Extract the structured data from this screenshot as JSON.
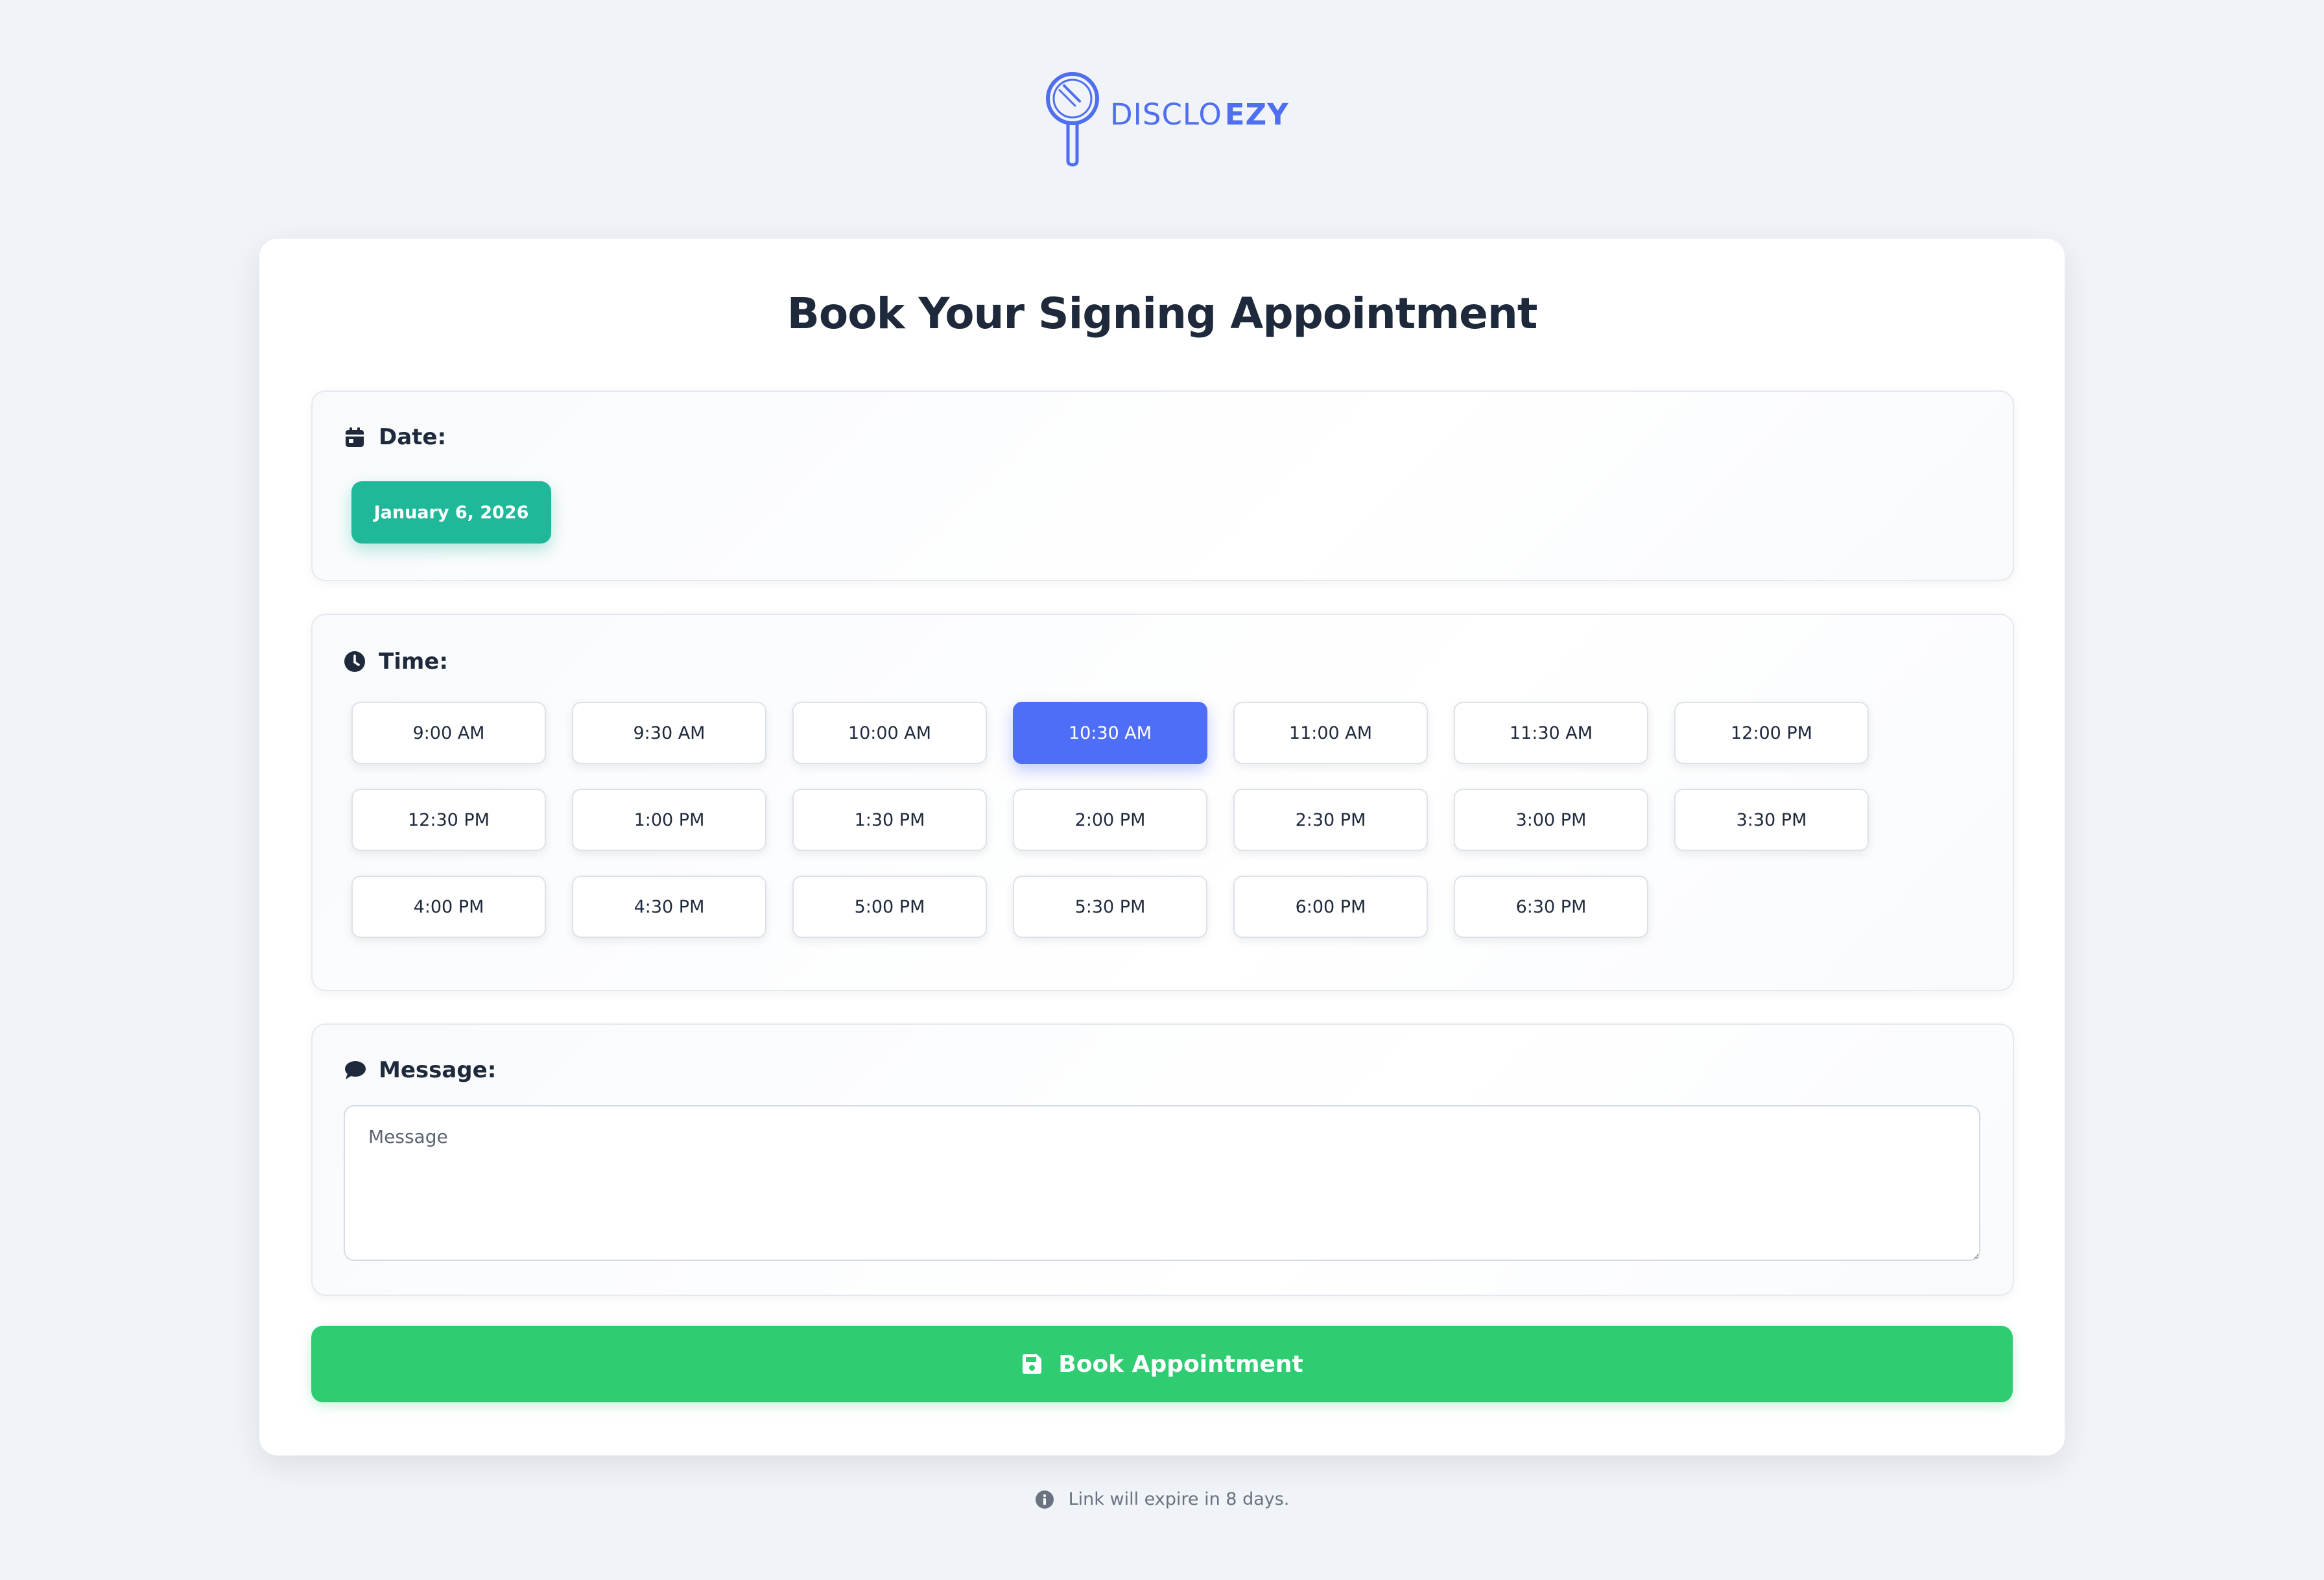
{
  "brand": {
    "name_light": "DISCLO",
    "name_bold": "EZY",
    "color": "#4f6ef0"
  },
  "page": {
    "title": "Book Your Signing Appointment"
  },
  "date_section": {
    "icon": "calendar-icon",
    "label": "Date:",
    "selected_date": "January 6, 2026",
    "pill_color": "#1fb99a"
  },
  "time_section": {
    "icon": "clock-icon",
    "label": "Time:",
    "selected": "10:30 AM",
    "selected_color": "#4f6ef7",
    "slots": [
      "9:00 AM",
      "9:30 AM",
      "10:00 AM",
      "10:30 AM",
      "11:00 AM",
      "11:30 AM",
      "12:00 PM",
      "12:30 PM",
      "1:00 PM",
      "1:30 PM",
      "2:00 PM",
      "2:30 PM",
      "3:00 PM",
      "3:30 PM",
      "4:00 PM",
      "4:30 PM",
      "5:00 PM",
      "5:30 PM",
      "6:00 PM",
      "6:30 PM"
    ]
  },
  "message_section": {
    "icon": "comment-icon",
    "label": "Message:",
    "value": "",
    "placeholder": "Message"
  },
  "book_button": {
    "icon": "save-icon",
    "label": "Book Appointment",
    "color": "#30cc72"
  },
  "footer": {
    "icon": "info-icon",
    "note": "Link will expire in 8 days."
  }
}
